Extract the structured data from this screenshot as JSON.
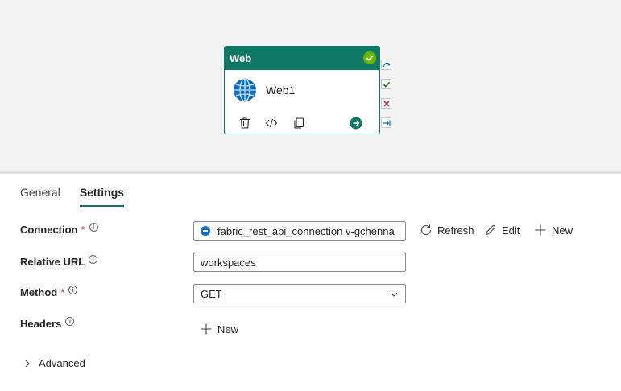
{
  "activity": {
    "type_label": "Web",
    "name": "Web1"
  },
  "tabs": [
    {
      "label": "General"
    },
    {
      "label": "Settings"
    }
  ],
  "form": {
    "connection": {
      "label": "Connection",
      "required_mark": "*",
      "value": "fabric_rest_api_connection v-gchenna",
      "refresh_label": "Refresh",
      "edit_label": "Edit",
      "new_label": "New"
    },
    "relative_url": {
      "label": "Relative URL",
      "value": "workspaces"
    },
    "method": {
      "label": "Method",
      "required_mark": "*",
      "value": "GET"
    },
    "headers": {
      "label": "Headers",
      "new_label": "New"
    },
    "advanced": {
      "label": "Advanced"
    }
  },
  "info_glyph": "i",
  "colors": {
    "accent": "#117865",
    "success": "#6bb700",
    "failure": "#c4314b",
    "canvas": "#f3f3f3"
  }
}
